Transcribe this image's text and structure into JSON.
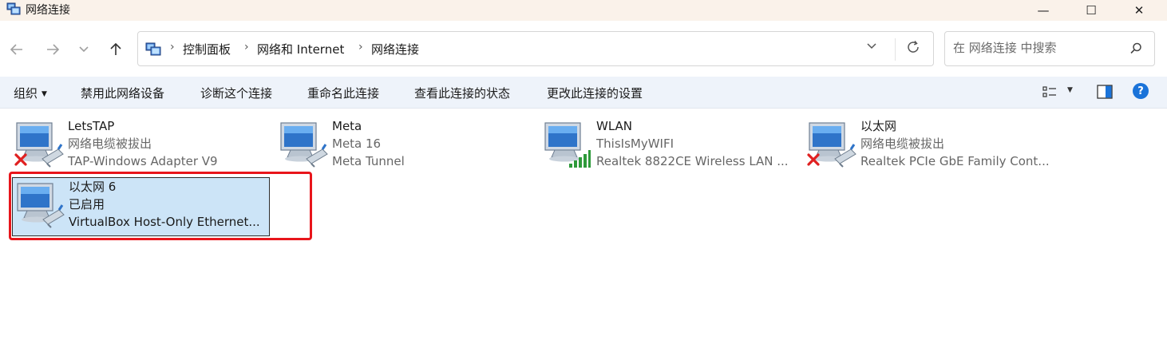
{
  "window": {
    "title": "网络连接",
    "minimize_glyph": "—",
    "maximize_glyph": "☐",
    "close_glyph": "✕"
  },
  "address": {
    "crumbs": [
      "控制面板",
      "网络和 Internet",
      "网络连接"
    ],
    "search_placeholder": "在 网络连接 中搜索"
  },
  "toolbar": {
    "organize": "组织",
    "disable": "禁用此网络设备",
    "diagnose": "诊断这个连接",
    "rename": "重命名此连接",
    "status": "查看此连接的状态",
    "settings": "更改此连接的设置"
  },
  "connections": [
    {
      "name": "LetsTAP",
      "status": "网络电缆被拔出",
      "device": "TAP-Windows Adapter V9",
      "state_icon": "red-x"
    },
    {
      "name": "Meta",
      "status": "Meta 16",
      "device": "Meta Tunnel",
      "state_icon": "cable"
    },
    {
      "name": "WLAN",
      "status": "ThisIsMyWIFI",
      "device": "Realtek 8822CE Wireless LAN ...",
      "state_icon": "wifi-signal"
    },
    {
      "name": "以太网",
      "status": "网络电缆被拔出",
      "device": "Realtek PCIe GbE Family Cont...",
      "state_icon": "red-x"
    },
    {
      "name": "以太网 6",
      "status": "已启用",
      "device": "VirtualBox Host-Only Ethernet...",
      "state_icon": "cable",
      "selected": true
    }
  ],
  "colors": {
    "selection_fill": "#cce4f7",
    "highlight_border": "#e8151b",
    "command_bar": "#eef3fa"
  }
}
